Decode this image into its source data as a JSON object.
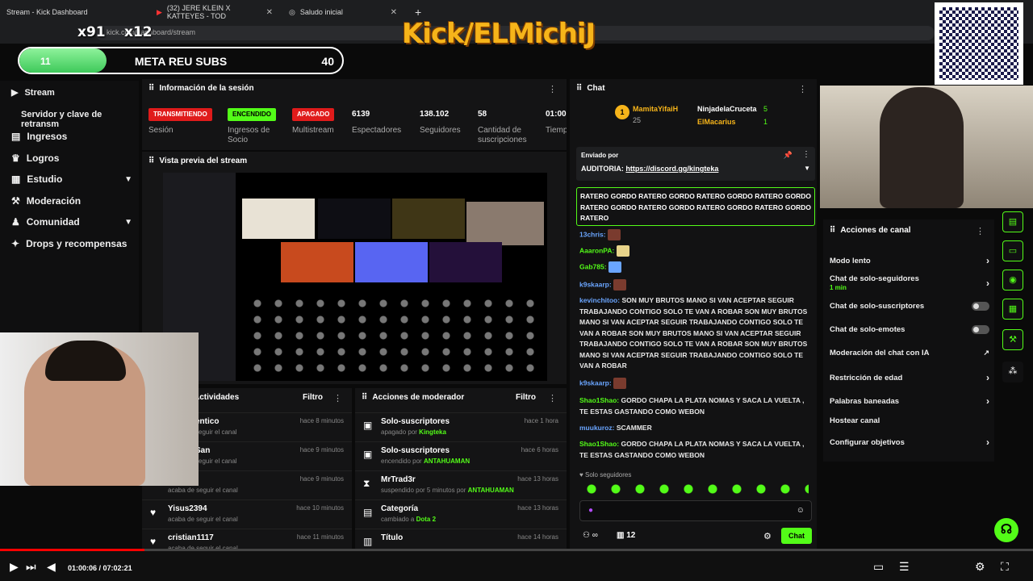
{
  "browser": {
    "tabs": [
      {
        "label": "Stream - Kick Dashboard"
      },
      {
        "label": "(32) JERE KLEIN X KATTEYES - TOD"
      },
      {
        "label": "Saludo inicial"
      }
    ],
    "url": "kick.com/dashboard/stream"
  },
  "overlay": {
    "brand": "Kick/ELMichiJ",
    "badge_left": "x91",
    "badge_right": "x12",
    "goal": {
      "title": "META REU SUBS",
      "current": "11",
      "target": "40",
      "progress": 0.27
    }
  },
  "sidebar": {
    "header": "Stream",
    "section": "Servidor y clave de retransm",
    "items": [
      {
        "label": "Ingresos",
        "icon": "bar-chart-icon"
      },
      {
        "label": "Logros",
        "icon": "trophy-icon"
      },
      {
        "label": "Estudio",
        "icon": "grid-icon",
        "expand": true
      },
      {
        "label": "Moderación",
        "icon": "hammer-icon"
      },
      {
        "label": "Comunidad",
        "icon": "people-icon",
        "expand": true
      },
      {
        "label": "Drops y recompensas",
        "icon": "gift-icon"
      }
    ]
  },
  "session": {
    "title": "Información de la sesión",
    "pills": [
      "TRANSMITIENDO",
      "ENCENDIDO",
      "APAGADO"
    ],
    "pill_labels": [
      "Sesión",
      "Ingresos de Socio",
      "Multistream"
    ],
    "stats": [
      {
        "value": "6139",
        "label": "Espectadores"
      },
      {
        "value": "138.102",
        "label": "Seguidores"
      },
      {
        "value": "58",
        "label": "Cantidad de suscripciones"
      },
      {
        "value": "01:00",
        "label": "Tiempo en vivo"
      }
    ]
  },
  "preview": {
    "title": "Vista previa del stream"
  },
  "activity": {
    "title": "Actividades",
    "filter": "Filtro",
    "rows": [
      {
        "name": "entico",
        "sub": "seguir el canal",
        "time": "hace 8 minutos"
      },
      {
        "name": "San",
        "sub": "seguir el canal",
        "time": "hace 9 minutos"
      },
      {
        "name": "",
        "sub": "acaba de seguir el canal",
        "time": "hace 9 minutos"
      },
      {
        "name": "Yisus2394",
        "sub": "acaba de seguir el canal",
        "time": "hace 10 minutos"
      },
      {
        "name": "cristian1117",
        "sub": "acaba de seguir el canal",
        "time": "hace 11 minutos"
      }
    ]
  },
  "modactions": {
    "title": "Acciones de moderador",
    "filter": "Filtro",
    "rows": [
      {
        "name": "Solo-suscriptores",
        "sub": "apagado por",
        "who": "Kingteka",
        "time": "hace 1 hora"
      },
      {
        "name": "Solo-suscriptores",
        "sub": "encendido por",
        "who": "ANTAHUAMAN",
        "time": "hace 6 horas"
      },
      {
        "name": "MrTrad3r",
        "sub": "suspendido por 5 minutos por",
        "who": "ANTAHUAMAN",
        "time": "hace 13 horas"
      },
      {
        "name": "Categoría",
        "sub": "cambiado a",
        "who": "Dota 2",
        "time": "hace 13 horas"
      },
      {
        "name": "Título",
        "sub": "",
        "who": "",
        "time": "hace 14 horas"
      }
    ]
  },
  "chat": {
    "title": "Chat",
    "top_gifters": [
      {
        "name": "MamitaYifaiH",
        "count": "25"
      },
      {
        "name": "NinjadelaCruceta",
        "count": "5"
      },
      {
        "name": "ElMacarius",
        "count": "1"
      }
    ],
    "pinned_by": "Enviado por",
    "pinned_text": "AUDITORIA:",
    "pinned_link": "https://discord.gg/kingteka",
    "spam": "RATERO GORDO RATERO GORDO RATERO GORDO RATERO GORDO RATERO GORDO RATERO GORDO RATERO GORDO RATERO GORDO RATERO",
    "messages": [
      {
        "user": "13chris:",
        "text": ""
      },
      {
        "user": "AaaronPA:",
        "text": ""
      },
      {
        "user": "Gab785:",
        "text": ""
      },
      {
        "user": "k9skaarp:",
        "text": ""
      },
      {
        "user": "kevinchitoo:",
        "text": "SON MUY BRUTOS MANO SI VAN ACEPTAR SEGUIR TRABAJANDO CONTIGO SOLO TE VAN A ROBAR SON MUY BRUTOS MANO SI VAN ACEPTAR SEGUIR TRABAJANDO CONTIGO SOLO TE VAN A ROBAR SON MUY BRUTOS MANO SI VAN ACEPTAR SEGUIR TRABAJANDO CONTIGO SOLO TE VAN A ROBAR SON MUY BRUTOS MANO SI VAN ACEPTAR SEGUIR TRABAJANDO CONTIGO SOLO TE VAN A ROBAR"
      },
      {
        "user": "k9skaarp:",
        "text": ""
      },
      {
        "user": "Shao1Shao:",
        "text": "GORDO CHAPA LA PLATA NOMAS Y SACA LA VUELTA , TE ESTAS GASTANDO COMO WEBON"
      },
      {
        "user": "muukuroz:",
        "text": "SCAMMER"
      },
      {
        "user": "Shao1Shao:",
        "text": "GORDO CHAPA LA PLATA NOMAS Y SACA LA VUELTA , TE ESTAS GASTANDO COMO WEBON"
      }
    ],
    "mode": "Solo seguidores",
    "viewers": "12",
    "send": "Chat"
  },
  "channel_actions": {
    "title": "Acciones de canal",
    "items": [
      {
        "label": "Modo lento",
        "kind": "chev"
      },
      {
        "label": "Chat de solo-seguidores",
        "sub": "1 min",
        "kind": "chev"
      },
      {
        "label": "Chat de solo-suscriptores",
        "kind": "toggle"
      },
      {
        "label": "Chat de solo-emotes",
        "kind": "toggle"
      },
      {
        "label": "Moderación del chat con IA",
        "kind": "ext"
      },
      {
        "label": "Restricción de edad",
        "kind": "chev"
      },
      {
        "label": "Palabras baneadas",
        "kind": "chev"
      },
      {
        "label": "Hostear canal",
        "kind": ""
      },
      {
        "label": "Configurar objetivos",
        "kind": "chev"
      }
    ]
  },
  "player": {
    "current": "01:00:06",
    "total": "07:02:21",
    "progress": 0.14
  }
}
